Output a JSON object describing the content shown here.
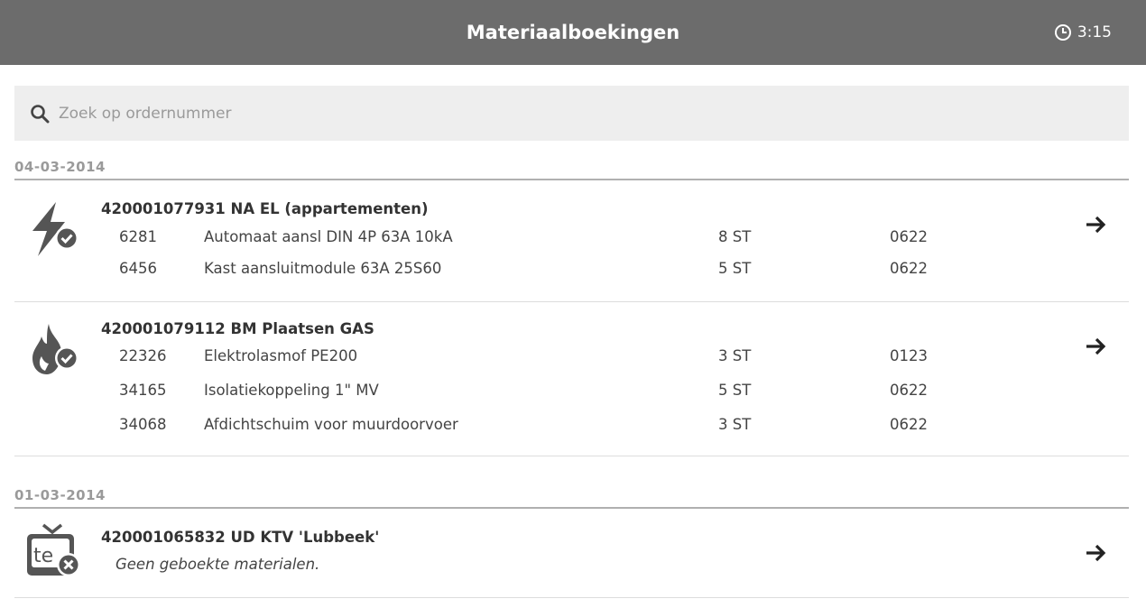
{
  "header": {
    "title": "Materiaalboekingen",
    "time": "3:15"
  },
  "search": {
    "placeholder": "Zoek op ordernummer",
    "value": ""
  },
  "groups": [
    {
      "date": "04-03-2014",
      "orders": [
        {
          "title": "420001077931 NA EL (appartementen)",
          "icon": "electricity-check-icon",
          "items": [
            {
              "code": "6281",
              "description": "Automaat aansl DIN 4P 63A 10kA",
              "quantity": "8 ST",
              "ref": "0622"
            },
            {
              "code": "6456",
              "description": "Kast aansluitmodule 63A 25S60",
              "quantity": "5 ST",
              "ref": "0622"
            }
          ]
        },
        {
          "title": "420001079112 BM Plaatsen GAS",
          "icon": "gas-flame-check-icon",
          "items": [
            {
              "code": "22326",
              "description": "Elektrolasmof PE200",
              "quantity": "3 ST",
              "ref": "0123"
            },
            {
              "code": "34165",
              "description": "Isolatiekoppeling 1\" MV",
              "quantity": "5 ST",
              "ref": "0622"
            },
            {
              "code": "34068",
              "description": "Afdichtschuim voor muurdoorvoer",
              "quantity": "3 ST",
              "ref": "0622"
            }
          ]
        }
      ]
    },
    {
      "date": "01-03-2014",
      "orders": [
        {
          "title": "420001065832 UD KTV 'Lubbeek'",
          "icon": "tv-tele-cross-icon",
          "no_materials": "Geen geboekte materialen.",
          "items": []
        }
      ]
    }
  ],
  "colors": {
    "topbar": "#6c6c6c",
    "search_bg": "#eeeeee",
    "date_text": "#9a9a9a",
    "text": "#333333"
  }
}
